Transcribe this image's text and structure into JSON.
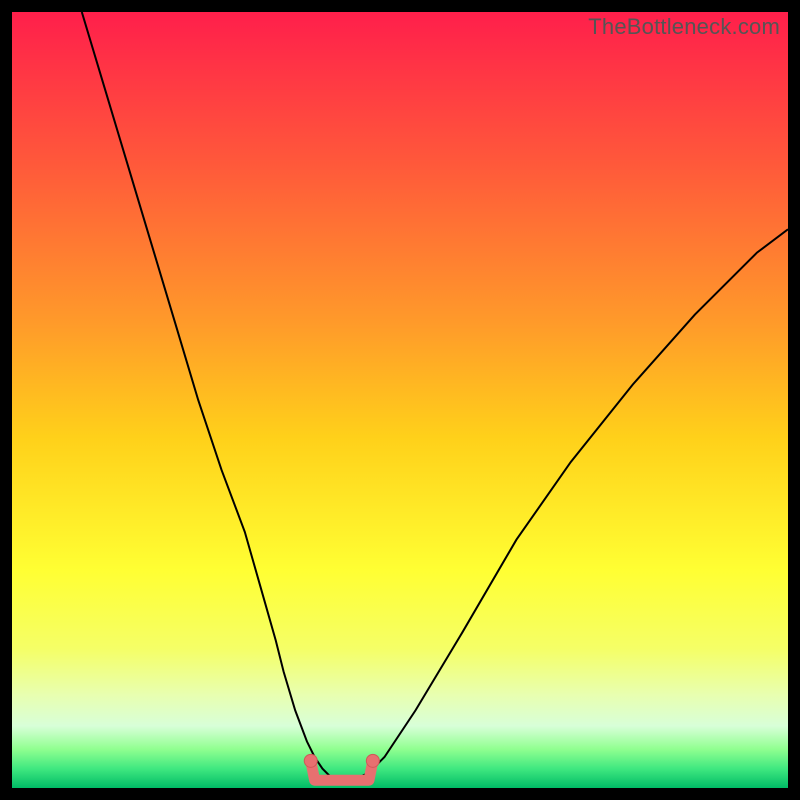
{
  "watermark": "TheBottleneck.com",
  "colors": {
    "frame": "#000000",
    "gradient_stops": [
      {
        "offset": 0,
        "color": "#ff1f4b"
      },
      {
        "offset": 0.2,
        "color": "#ff5a3a"
      },
      {
        "offset": 0.4,
        "color": "#ff9a2a"
      },
      {
        "offset": 0.55,
        "color": "#ffd11a"
      },
      {
        "offset": 0.72,
        "color": "#ffff33"
      },
      {
        "offset": 0.82,
        "color": "#f5ff66"
      },
      {
        "offset": 0.88,
        "color": "#e8ffb0"
      },
      {
        "offset": 0.92,
        "color": "#d8ffd8"
      },
      {
        "offset": 0.95,
        "color": "#90ff90"
      },
      {
        "offset": 0.975,
        "color": "#40e880"
      },
      {
        "offset": 1.0,
        "color": "#00bb66"
      }
    ],
    "curve": "#000000",
    "marker_fill": "#e77070",
    "marker_stroke": "#d05858"
  },
  "chart_data": {
    "type": "line",
    "title": "",
    "xlabel": "",
    "ylabel": "",
    "xlim": [
      0,
      100
    ],
    "ylim": [
      0,
      100
    ],
    "x": [
      9,
      12,
      15,
      18,
      21,
      24,
      27,
      30,
      32,
      34,
      35,
      36.5,
      38,
      39,
      40,
      41,
      42,
      43,
      44,
      45,
      46,
      48,
      52,
      58,
      65,
      72,
      80,
      88,
      96,
      100
    ],
    "values": [
      100,
      90,
      80,
      70,
      60,
      50,
      41,
      33,
      26,
      19,
      15,
      10,
      6,
      4,
      2.5,
      1.5,
      1,
      1,
      1,
      1.5,
      2,
      4,
      10,
      20,
      32,
      42,
      52,
      61,
      69,
      72
    ],
    "flat_region": {
      "x_start": 38.5,
      "x_end": 46.5,
      "y": 1
    },
    "left_endpoint": {
      "x": 38.5,
      "y": 3.5
    },
    "right_endpoint": {
      "x": 46.5,
      "y": 3.5
    }
  }
}
